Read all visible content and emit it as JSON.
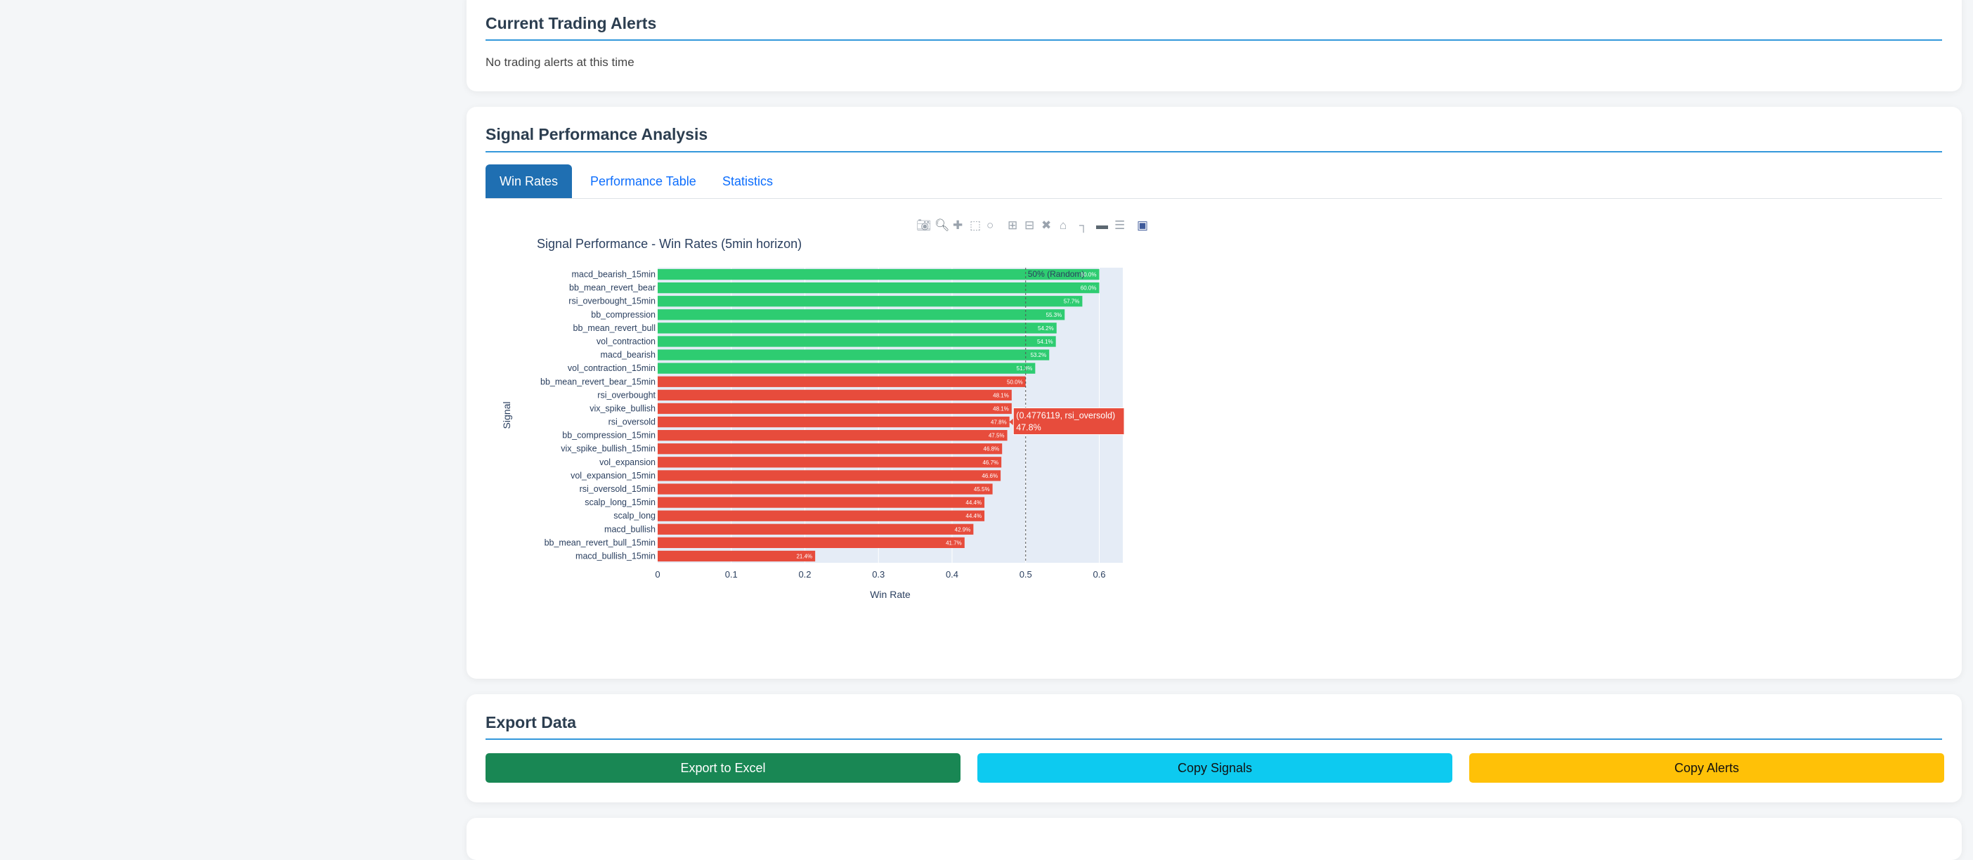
{
  "alerts": {
    "title": "Current Trading Alerts",
    "empty_text": "No trading alerts at this time"
  },
  "performance": {
    "title": "Signal Performance Analysis",
    "tabs": [
      {
        "label": "Win Rates",
        "active": true
      },
      {
        "label": "Performance Table",
        "active": false
      },
      {
        "label": "Statistics",
        "active": false
      }
    ],
    "modebar_icons": [
      "camera-icon",
      "zoom-icon",
      "pan-icon",
      "box-select-icon",
      "lasso-select-icon",
      "zoom-in-icon",
      "zoom-out-icon",
      "autoscale-icon",
      "reset-axes-icon",
      "spike-lines-icon",
      "hover-closest-icon",
      "hover-compare-icon",
      "plotly-logo-icon"
    ]
  },
  "chart_data": {
    "type": "bar",
    "orientation": "horizontal",
    "title": "Signal Performance - Win Rates (5min horizon)",
    "xlabel": "Win Rate",
    "ylabel": "Signal",
    "xlim": [
      0,
      0.632
    ],
    "xticks": [
      0,
      0.1,
      0.2,
      0.3,
      0.4,
      0.5,
      0.6
    ],
    "xtick_labels": [
      "0",
      "0.1",
      "0.2",
      "0.3",
      "0.4",
      "0.5",
      "0.6"
    ],
    "reference_line": {
      "x": 0.5,
      "label": "50% (Random)"
    },
    "colors": {
      "above": "#2ecc71",
      "below": "#e74c3c",
      "plot_bg": "#e5ecf6"
    },
    "categories": [
      "macd_bearish_15min",
      "bb_mean_revert_bear",
      "rsi_overbought_15min",
      "bb_compression",
      "bb_mean_revert_bull",
      "vol_contraction",
      "macd_bearish",
      "vol_contraction_15min",
      "bb_mean_revert_bear_15min",
      "rsi_overbought",
      "vix_spike_bullish",
      "rsi_oversold",
      "bb_compression_15min",
      "vix_spike_bullish_15min",
      "vol_expansion",
      "vol_expansion_15min",
      "rsi_oversold_15min",
      "scalp_long_15min",
      "scalp_long",
      "macd_bullish",
      "bb_mean_revert_bull_15min",
      "macd_bullish_15min"
    ],
    "values": [
      0.6,
      0.6,
      0.577,
      0.553,
      0.542,
      0.541,
      0.532,
      0.513,
      0.5,
      0.481,
      0.481,
      0.478,
      0.475,
      0.468,
      0.467,
      0.466,
      0.455,
      0.444,
      0.444,
      0.429,
      0.417,
      0.214
    ],
    "data_labels": [
      "60.0%",
      "60.0%",
      "57.7%",
      "55.3%",
      "54.2%",
      "54.1%",
      "53.2%",
      "51.3%",
      "50.0%",
      "48.1%",
      "48.1%",
      "47.8%",
      "47.5%",
      "46.8%",
      "46.7%",
      "46.6%",
      "45.5%",
      "44.4%",
      "44.4%",
      "42.9%",
      "41.7%",
      "21.4%"
    ],
    "tooltip": {
      "line1": "(0.4776119, rsi_oversold)",
      "line2": "47.8%",
      "category": "rsi_oversold",
      "value": 0.4776119
    }
  },
  "export": {
    "title": "Export Data",
    "excel_label": "Export to Excel",
    "signals_label": "Copy Signals",
    "alerts_label": "Copy Alerts"
  }
}
